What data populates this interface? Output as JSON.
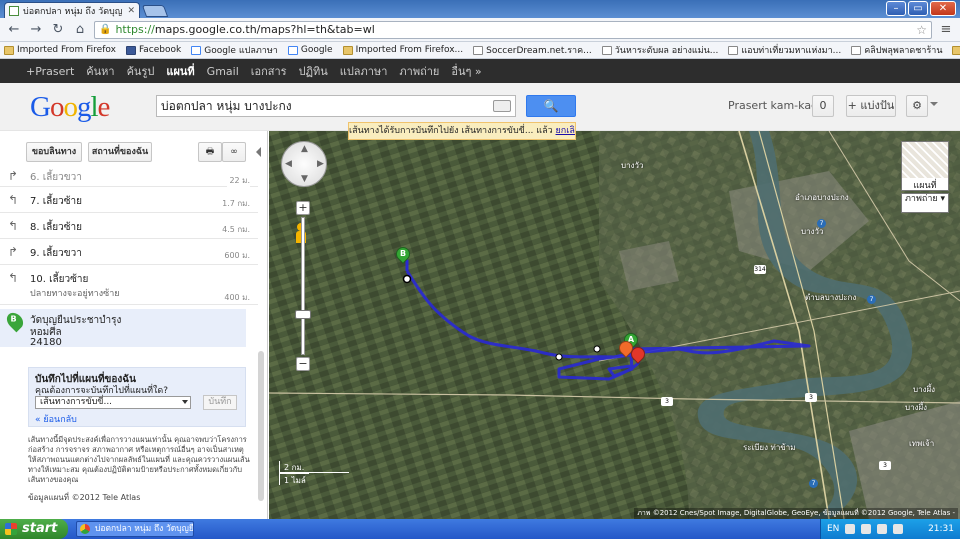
{
  "browser": {
    "tab_title": "บ่อตกปลา หนุ่ม ถึง วัดบุญยืนประชาบำรุ",
    "url_https": "https://",
    "url_rest": "maps.google.co.th/maps?hl=th&tab=wl",
    "bookmarks": [
      {
        "label": "Imported From Firefox",
        "icon": "folder"
      },
      {
        "label": "Facebook",
        "icon": "facebook"
      },
      {
        "label": "Google แปลภาษา",
        "icon": "google"
      },
      {
        "label": "Google",
        "icon": "google"
      },
      {
        "label": "Imported From Firefox...",
        "icon": "folder"
      },
      {
        "label": "SoccerDream.net.ราค...",
        "icon": "page"
      },
      {
        "label": "วันหาระดับผล อย่างแม่น...",
        "icon": "page"
      },
      {
        "label": "แอบท่าเที่ยวมหาแห่งมา...",
        "icon": "page"
      },
      {
        "label": "คลิปพลุพลาดชาร้าน",
        "icon": "page"
      }
    ],
    "other_bookmarks": "Other bookmarks"
  },
  "gbar": {
    "items": [
      "+Prasert",
      "ค้นหา",
      "ค้นรูป",
      "แผนที่",
      "Gmail",
      "เอกสาร",
      "ปฏิทิน",
      "แปลภาษา",
      "ภาพถ่าย",
      "อื่นๆ »"
    ],
    "active_index": 3
  },
  "header": {
    "search_value": "บ่อตกปลา หนุ่ม บางปะกง",
    "user": "Prasert kam-kaew",
    "count": "0",
    "share_label": "+ แบ่งปัน"
  },
  "notice": {
    "text": "เส้นทางได้รับการบันทึกไปยัง เส้นทางการขับขี่... แล้ว",
    "undo": "ยกเลิกแก้"
  },
  "panel": {
    "tool1": "ขอบลินทาง",
    "tool2": "สถานที่ของฉัน",
    "first_step": {
      "text": "6. เลี้ยวขวา",
      "dist": "22 ม."
    },
    "steps": [
      {
        "text": "7. เลี้ยวซ้าย",
        "dist": "1.7 กม.",
        "dir": "left"
      },
      {
        "text": "8. เลี้ยวซ้าย",
        "dist": "4.5 กม.",
        "dir": "left"
      },
      {
        "text": "9. เลี้ยวขวา",
        "dist": "600 ม.",
        "dir": "right"
      },
      {
        "text": "10. เลี้ยวซ้าย",
        "sub": "ปลายทางจะอยู่ทางซ้าย",
        "dist": "400 ม.",
        "dir": "left"
      }
    ],
    "destination": {
      "marker": "B",
      "name": "วัดบุญยืนประชาบำรุง",
      "line2": "หอมศีล",
      "line3": "24180"
    },
    "save": {
      "title": "บันทึกไปที่แผนที่ของฉัน",
      "question": "คุณต้องการจะบันทึกไปที่แผนที่ใด?",
      "selected": "เส้นทางการขับขี่...",
      "save_btn": "บันทึก",
      "back": "« ย้อนกลับ"
    },
    "disclaimer": "เส้นทางนี้มีจุดประสงค์เพื่อการวางแผนเท่านั้น คุณอาจพบว่าโครงการก่อสร้าง การจราจร สภาพอากาศ หรือเหตุการณ์อื่นๆ อาจเป็นสาเหตุให้สภาพถนนแตกต่างไปจากผลลัพธ์ในแผนที่ และคุณควรวางแผนเส้นทางให้เหมาะสม คุณต้องปฏิบัติตามป้ายหรือประกาศทั้งหมดเกี่ยวกับเส้นทางของคุณ",
    "copyright": "ข้อมูลแผนที่ ©2012 Tele Atlas"
  },
  "map": {
    "maptype_map": "แผนที่",
    "maptype_sat": "ภาพถ่าย",
    "scale_km": "2 กม.",
    "scale_mi": "1 ไมล์",
    "attribution": "ภาพ ©2012 Cnes/Spot Image, DigitalGlobe, GeoEye, ข้อมูลแผนที่ ©2012 Google, Tele Atlas -",
    "pin_a": "A",
    "pin_b": "B",
    "labels": {
      "town1": "บางวัว",
      "town2": "อำเภอบางปะกง",
      "town3": "บางวัว",
      "town4": "ตำบลบางปะกง",
      "town5": "บางผึ้ง",
      "town6": "บางผึ้ง",
      "town7": "เทพเจ้า",
      "town8": "ระเบียง ท่าข้าม"
    },
    "shields": {
      "r1": "314",
      "r2": "7",
      "r3": "3",
      "r4": "3",
      "r5": "7",
      "r6": "3",
      "r7": "7"
    }
  },
  "taskbar": {
    "start": "start",
    "task": "บ่อตกปลา หนุ่ม ถึง วัดบุญยืนประ...",
    "lang": "EN",
    "clock": "21:31"
  }
}
